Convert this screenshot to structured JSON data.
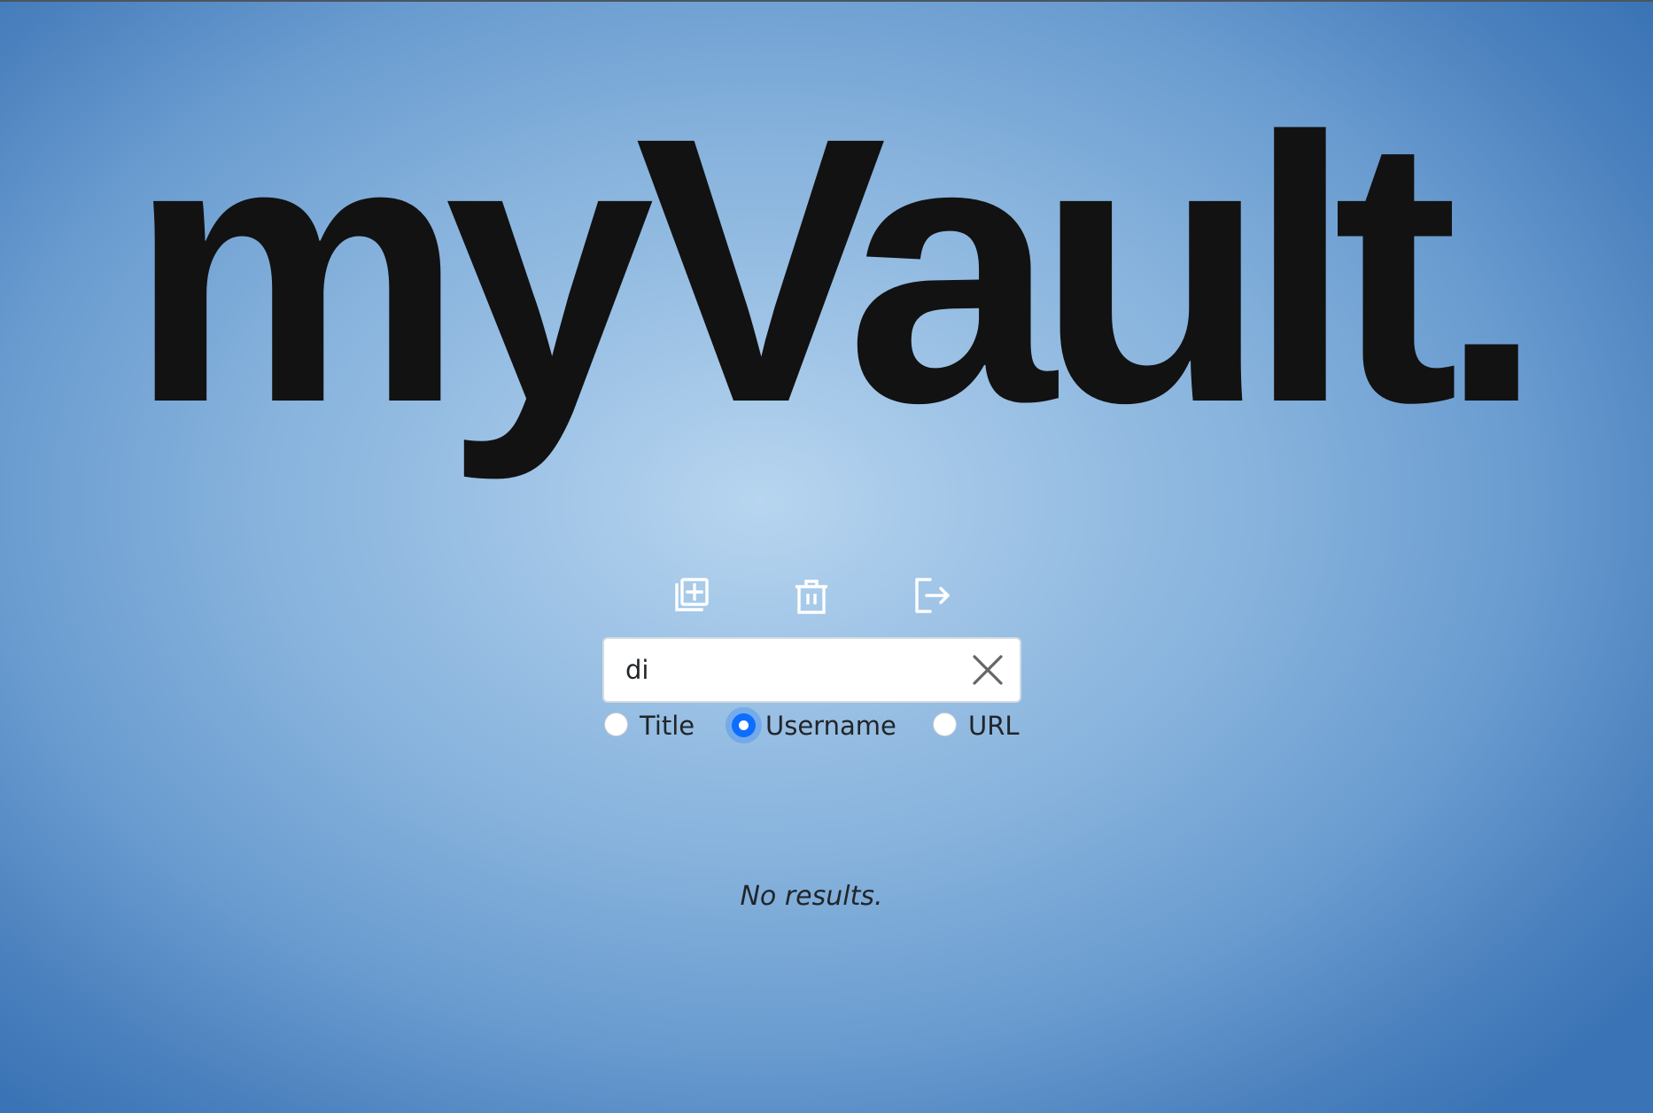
{
  "app": {
    "title": "myVault."
  },
  "toolbar": {
    "buttons": [
      {
        "name": "add",
        "icon": "add-copy-icon"
      },
      {
        "name": "delete",
        "icon": "trash-icon"
      },
      {
        "name": "logout",
        "icon": "logout-icon"
      }
    ],
    "icon_color": "#ffffff"
  },
  "search": {
    "value": "di",
    "clear_icon": "close-icon"
  },
  "filter": {
    "options": [
      "Title",
      "Username",
      "URL"
    ],
    "selected": "Username",
    "accent_color": "#0d6efd"
  },
  "results": {
    "empty_text": "No results."
  }
}
